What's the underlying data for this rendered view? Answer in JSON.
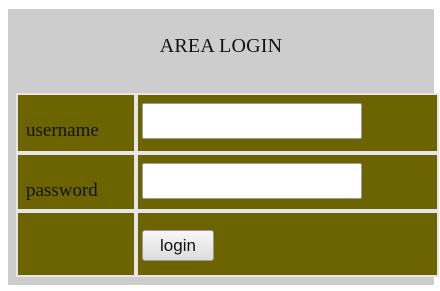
{
  "login": {
    "title": "AREA LOGIN",
    "username_label": "username",
    "password_label": "password",
    "username_value": "",
    "password_value": "",
    "button_label": "login"
  },
  "colors": {
    "panel_background": "#cdcdcd",
    "cell_background": "#6b6400",
    "table_border": "#e6e6e6",
    "input_background": "#ffffff"
  }
}
